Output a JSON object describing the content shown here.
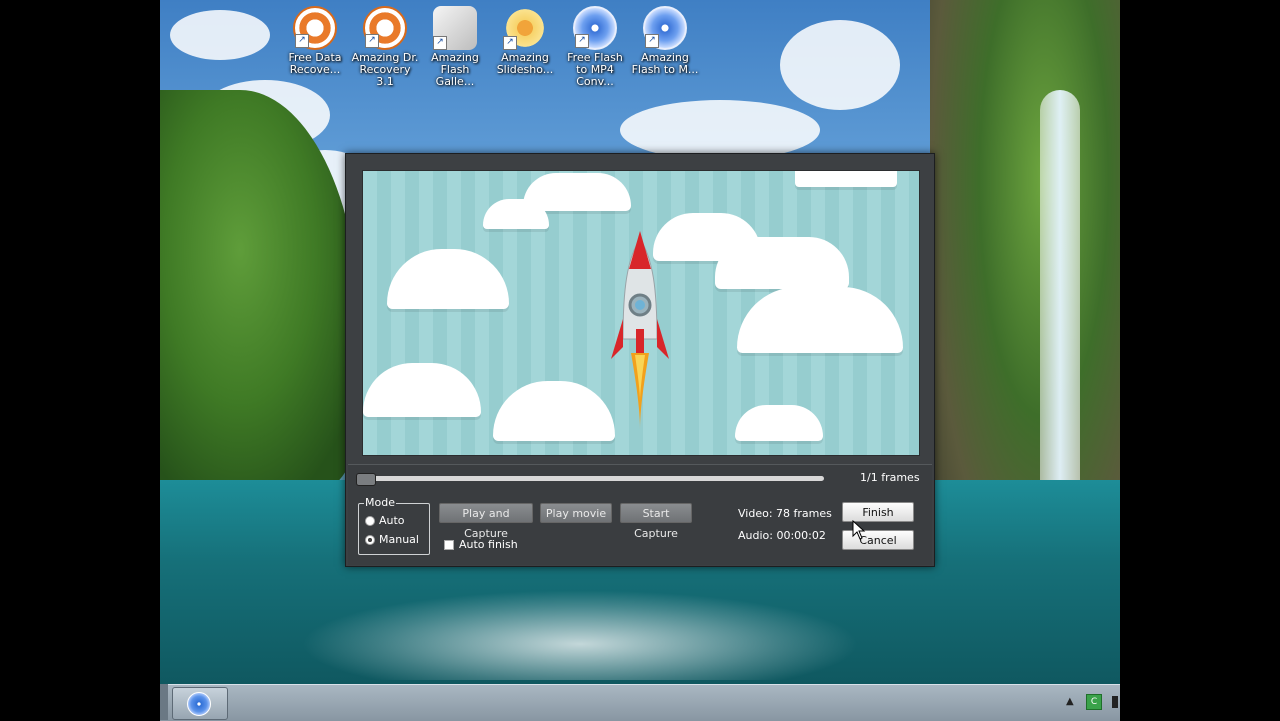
{
  "desktop": {
    "icons": [
      {
        "label": "Free Data Recove...",
        "icon": "lifebuoy-icon"
      },
      {
        "label": "Amazing Dr. Recovery 3.1",
        "icon": "lifebuoy-icon"
      },
      {
        "label": "Amazing Flash Galle...",
        "icon": "film-projector-icon"
      },
      {
        "label": "Amazing Slidesho...",
        "icon": "flower-icon"
      },
      {
        "label": "Free Flash to MP4 Conv...",
        "icon": "disc-icon"
      },
      {
        "label": "Amazing Flash to M...",
        "icon": "disc-icon"
      }
    ]
  },
  "dialog": {
    "frames": "1/1  frames",
    "mode": {
      "title": "Mode",
      "auto_label": "Auto",
      "manual_label": "Manual",
      "selected": "Manual"
    },
    "buttons": {
      "play_and_capture": "Play and Capture",
      "play_movie": "Play movie",
      "start_capture": "Start Capture",
      "finish": "Finish",
      "cancel": "Cancel"
    },
    "auto_finish_label": "Auto finish",
    "auto_finish_checked": false,
    "video_info": "Video: 78 frames",
    "audio_info": "Audio: 00:00:02"
  },
  "colors": {
    "dialog_bg": "#3d4043",
    "preview_teal": "#a3d6d8",
    "rocket_red": "#d8262a"
  }
}
